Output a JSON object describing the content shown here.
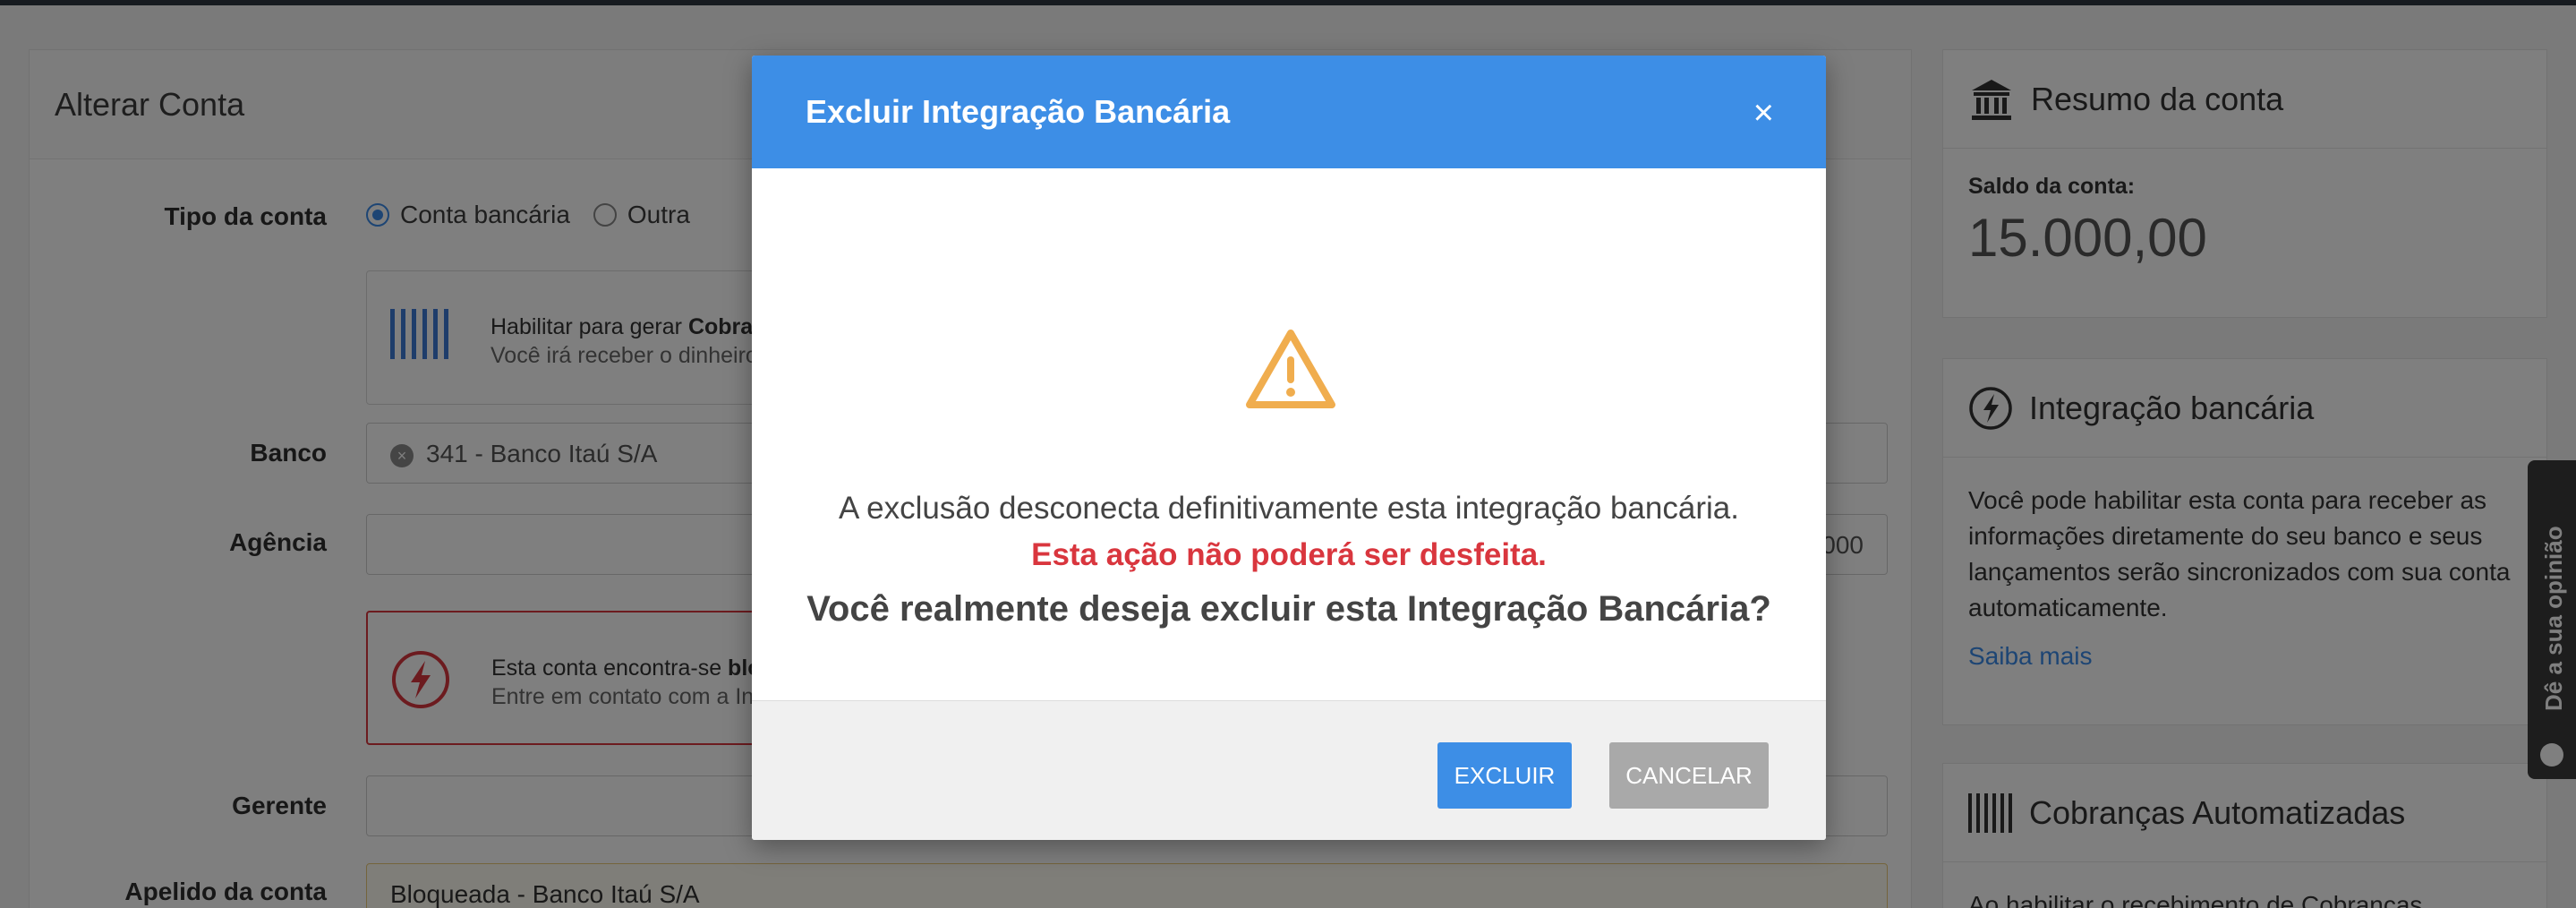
{
  "page": {
    "panel_title": "Alterar Conta",
    "account_type": {
      "label": "Tipo da conta",
      "options": [
        "Conta bancária",
        "Outra"
      ],
      "selected": "Conta bancária"
    },
    "charges_info": {
      "text_prefix": "Habilitar para gerar ",
      "text_bold": "Cobrar",
      "subtext": "Você irá receber o dinheiro"
    },
    "bank": {
      "label": "Banco",
      "value": "341 - Banco Itaú S/A"
    },
    "agency": {
      "label": "Agência",
      "value": "000"
    },
    "blocked_info": {
      "text_prefix": "Esta conta encontra-se ",
      "text_bold": "blo",
      "subtext": "Entre em contato com a Ins"
    },
    "manager": {
      "label": "Gerente",
      "value": ""
    },
    "nickname": {
      "label": "Apelido da conta",
      "value": "Bloqueada - Banco Itaú S/A"
    }
  },
  "sidebar": {
    "summary": {
      "title": "Resumo da conta",
      "balance_label": "Saldo da conta:",
      "balance_value": "15.000,00"
    },
    "integration": {
      "title": "Integração bancária",
      "text": "Você pode habilitar esta conta para receber as informações diretamente do seu banco e seus lançamentos serão sincronizados com sua conta automaticamente.",
      "link": "Saiba mais"
    },
    "charges": {
      "title": "Cobranças Automatizadas",
      "text": "Ao habilitar o recebimento de Cobranças"
    }
  },
  "feedback": {
    "label": "Dê a sua opinião"
  },
  "modal": {
    "title": "Excluir Integração Bancária",
    "close": "×",
    "message": "A exclusão desconecta definitivamente esta integração bancária.",
    "warning": "Esta ação não poderá ser desfeita.",
    "question": "Você realmente deseja excluir esta Integração Bancária?",
    "confirm_label": "EXCLUIR",
    "cancel_label": "CANCELAR"
  },
  "colors": {
    "primary": "#3d8ee6",
    "danger": "#d9363e",
    "warning": "#f0ad4e",
    "cancel": "#a9a9a9"
  }
}
